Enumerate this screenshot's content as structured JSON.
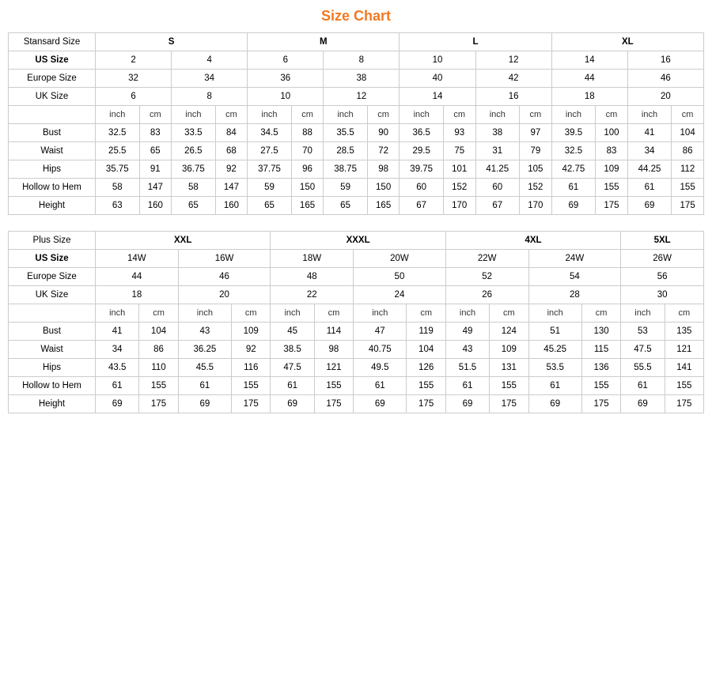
{
  "title": "Size Chart",
  "standard": {
    "headers": {
      "label": "Stansard Size",
      "cols": [
        {
          "label": "S",
          "span": 4
        },
        {
          "label": "M",
          "span": 4
        },
        {
          "label": "L",
          "span": 4
        },
        {
          "label": "XL",
          "span": 4
        }
      ]
    },
    "rows": {
      "us_size": {
        "label": "US Size",
        "vals": [
          "2",
          "4",
          "6",
          "8",
          "10",
          "12",
          "14",
          "16"
        ]
      },
      "europe_size": {
        "label": "Europe Size",
        "vals": [
          "32",
          "34",
          "36",
          "38",
          "40",
          "42",
          "44",
          "46"
        ]
      },
      "uk_size": {
        "label": "UK Size",
        "vals": [
          "6",
          "8",
          "10",
          "12",
          "14",
          "16",
          "18",
          "20"
        ]
      },
      "units": [
        "inch",
        "cm",
        "inch",
        "cm",
        "inch",
        "cm",
        "inch",
        "cm",
        "inch",
        "cm",
        "inch",
        "cm",
        "inch",
        "cm",
        "inch",
        "cm"
      ],
      "bust": {
        "label": "Bust",
        "vals": [
          "32.5",
          "83",
          "33.5",
          "84",
          "34.5",
          "88",
          "35.5",
          "90",
          "36.5",
          "93",
          "38",
          "97",
          "39.5",
          "100",
          "41",
          "104"
        ]
      },
      "waist": {
        "label": "Waist",
        "vals": [
          "25.5",
          "65",
          "26.5",
          "68",
          "27.5",
          "70",
          "28.5",
          "72",
          "29.5",
          "75",
          "31",
          "79",
          "32.5",
          "83",
          "34",
          "86"
        ]
      },
      "hips": {
        "label": "Hips",
        "vals": [
          "35.75",
          "91",
          "36.75",
          "92",
          "37.75",
          "96",
          "38.75",
          "98",
          "39.75",
          "101",
          "41.25",
          "105",
          "42.75",
          "109",
          "44.25",
          "112"
        ]
      },
      "hollow": {
        "label": "Hollow to Hem",
        "vals": [
          "58",
          "147",
          "58",
          "147",
          "59",
          "150",
          "59",
          "150",
          "60",
          "152",
          "60",
          "152",
          "61",
          "155",
          "61",
          "155"
        ]
      },
      "height": {
        "label": "Height",
        "vals": [
          "63",
          "160",
          "65",
          "160",
          "65",
          "165",
          "65",
          "165",
          "67",
          "170",
          "67",
          "170",
          "69",
          "175",
          "69",
          "175"
        ]
      }
    }
  },
  "plus": {
    "headers": {
      "label": "Plus Size",
      "cols": [
        {
          "label": "XXL",
          "span": 4
        },
        {
          "label": "XXXL",
          "span": 4
        },
        {
          "label": "4XL",
          "span": 4
        },
        {
          "label": "5XL",
          "span": 2
        }
      ]
    },
    "rows": {
      "us_size": {
        "label": "US Size",
        "vals": [
          "14W",
          "16W",
          "18W",
          "20W",
          "22W",
          "24W",
          "26W"
        ]
      },
      "europe_size": {
        "label": "Europe Size",
        "vals": [
          "44",
          "46",
          "48",
          "50",
          "52",
          "54",
          "56"
        ]
      },
      "uk_size": {
        "label": "UK Size",
        "vals": [
          "18",
          "20",
          "22",
          "24",
          "26",
          "28",
          "30"
        ]
      },
      "units": [
        "inch",
        "cm",
        "inch",
        "cm",
        "inch",
        "cm",
        "inch",
        "cm",
        "inch",
        "cm",
        "inch",
        "cm",
        "inch",
        "cm"
      ],
      "bust": {
        "label": "Bust",
        "vals": [
          "41",
          "104",
          "43",
          "109",
          "45",
          "114",
          "47",
          "119",
          "49",
          "124",
          "51",
          "130",
          "53",
          "135"
        ]
      },
      "waist": {
        "label": "Waist",
        "vals": [
          "34",
          "86",
          "36.25",
          "92",
          "38.5",
          "98",
          "40.75",
          "104",
          "43",
          "109",
          "45.25",
          "115",
          "47.5",
          "121"
        ]
      },
      "hips": {
        "label": "Hips",
        "vals": [
          "43.5",
          "110",
          "45.5",
          "116",
          "47.5",
          "121",
          "49.5",
          "126",
          "51.5",
          "131",
          "53.5",
          "136",
          "55.5",
          "141"
        ]
      },
      "hollow": {
        "label": "Hollow to Hem",
        "vals": [
          "61",
          "155",
          "61",
          "155",
          "61",
          "155",
          "61",
          "155",
          "61",
          "155",
          "61",
          "155",
          "61",
          "155"
        ]
      },
      "height": {
        "label": "Height",
        "vals": [
          "69",
          "175",
          "69",
          "175",
          "69",
          "175",
          "69",
          "175",
          "69",
          "175",
          "69",
          "175",
          "69",
          "175"
        ]
      }
    }
  }
}
